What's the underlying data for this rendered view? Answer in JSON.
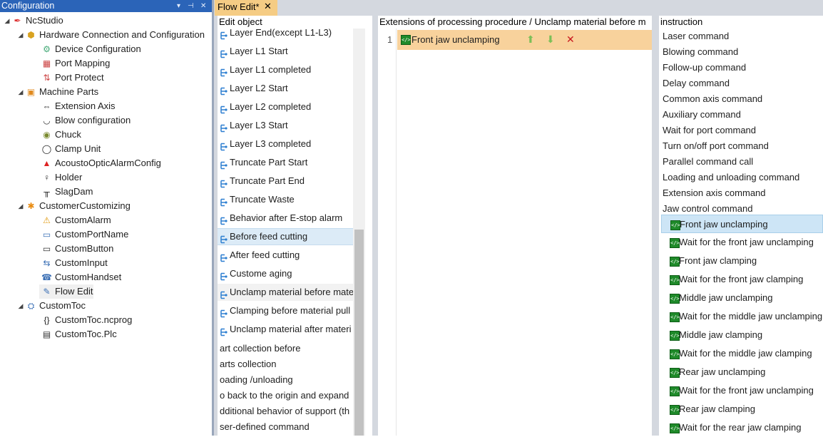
{
  "config_panel": {
    "title": "Configuration",
    "pin_glyph": "▾ ⊣ ✕",
    "tree": [
      {
        "label": "NcStudio",
        "icon": "ncstudio-icon",
        "level": 0,
        "expander": "◢"
      },
      {
        "label": "Hardware Connection and Configuration",
        "icon": "hardware-icon",
        "level": 1,
        "expander": "◢"
      },
      {
        "label": "Device Configuration",
        "icon": "device-config-icon",
        "level": 2
      },
      {
        "label": "Port Mapping",
        "icon": "port-mapping-icon",
        "level": 2
      },
      {
        "label": "Port Protect",
        "icon": "port-protect-icon",
        "level": 2
      },
      {
        "label": "Machine Parts",
        "icon": "machine-parts-icon",
        "level": 1,
        "expander": "◢"
      },
      {
        "label": "Extension Axis",
        "icon": "extension-axis-icon",
        "level": 2
      },
      {
        "label": "Blow configuration",
        "icon": "blow-icon",
        "level": 2
      },
      {
        "label": "Chuck",
        "icon": "chuck-icon",
        "level": 2
      },
      {
        "label": "Clamp Unit",
        "icon": "clamp-icon",
        "level": 2
      },
      {
        "label": "AcoustoOpticAlarmConfig",
        "icon": "alarm-light-icon",
        "level": 2
      },
      {
        "label": "Holder",
        "icon": "holder-icon",
        "level": 2
      },
      {
        "label": "SlagDam",
        "icon": "slagdam-icon",
        "level": 2
      },
      {
        "label": "CustomerCustomizing",
        "icon": "customizing-icon",
        "level": 1,
        "expander": "◢"
      },
      {
        "label": "CustomAlarm",
        "icon": "warning-icon",
        "level": 2
      },
      {
        "label": "CustomPortName",
        "icon": "port-name-icon",
        "level": 2
      },
      {
        "label": "CustomButton",
        "icon": "button-icon",
        "level": 2
      },
      {
        "label": "CustomInput",
        "icon": "input-icon",
        "level": 2
      },
      {
        "label": "CustomHandset",
        "icon": "handset-icon",
        "level": 2
      },
      {
        "label": "Flow Edit",
        "icon": "flow-edit-icon",
        "level": 2,
        "selected": true
      },
      {
        "label": "CustomToc",
        "icon": "customtoc-icon",
        "level": 1,
        "expander": "◢"
      },
      {
        "label": "CustomToc.ncprog",
        "icon": "ncprog-icon",
        "level": 2
      },
      {
        "label": "CustomToc.Plc",
        "icon": "plc-icon",
        "level": 2
      }
    ]
  },
  "tabs": {
    "active_label": "Flow Edit*",
    "close_glyph": "✕"
  },
  "edit_object": {
    "header": "Edit object",
    "items": [
      {
        "label": "Layer End(except L1-L3)",
        "icon": true
      },
      {
        "label": "Layer L1 Start",
        "icon": true
      },
      {
        "label": "Layer L1 completed",
        "icon": true
      },
      {
        "label": "Layer L2 Start",
        "icon": true
      },
      {
        "label": "Layer L2 completed",
        "icon": true
      },
      {
        "label": "Layer L3 Start",
        "icon": true
      },
      {
        "label": "Layer L3 completed",
        "icon": true
      },
      {
        "label": "Truncate Part Start",
        "icon": true
      },
      {
        "label": "Truncate Part End",
        "icon": true
      },
      {
        "label": "Truncate Waste",
        "icon": true
      },
      {
        "label": "Behavior after E-stop alarm",
        "icon": true
      },
      {
        "label": "Before feed cutting",
        "icon": true,
        "selected": true
      },
      {
        "label": "After feed cutting",
        "icon": true
      },
      {
        "label": "Custome aging",
        "icon": true
      },
      {
        "label": "Unclamp material before mate",
        "icon": true,
        "hover": true
      },
      {
        "label": "Clamping before material pull",
        "icon": true
      },
      {
        "label": "Unclamp material after materi",
        "icon": true
      },
      {
        "label": "art collection before",
        "icon": false
      },
      {
        "label": "arts collection",
        "icon": false
      },
      {
        "label": "oading /unloading",
        "icon": false
      },
      {
        "label": "o back to the origin and expand",
        "icon": false
      },
      {
        "label": "dditional behavior of support (th",
        "icon": false
      },
      {
        "label": "ser-defined command",
        "icon": false
      }
    ]
  },
  "extensions": {
    "header": "Extensions of processing procedure / Unclamp material before m",
    "rows": [
      {
        "line": "1",
        "label": "Front jaw unclamping"
      }
    ],
    "buttons": {
      "up_glyph": "⬆",
      "down_glyph": "⬇",
      "delete_glyph": "✕"
    }
  },
  "instruction": {
    "header": "instruction",
    "categories": [
      "Laser command",
      "Blowing command",
      "Follow-up command",
      "Delay command",
      "Common axis command",
      "Auxiliary command",
      "Wait for port command",
      "Turn on/off port command",
      "Parallel command call",
      "Loading and unloading command",
      "Extension axis command",
      "Jaw control command"
    ],
    "jaw_commands": [
      {
        "label": "Front jaw unclamping",
        "selected": true
      },
      {
        "label": "Wait for the front jaw unclamping"
      },
      {
        "label": "Front jaw clamping"
      },
      {
        "label": "Wait for the front jaw clamping"
      },
      {
        "label": "Middle jaw unclamping"
      },
      {
        "label": "Wait for the middle jaw unclamping"
      },
      {
        "label": "Middle jaw clamping"
      },
      {
        "label": "Wait for the middle jaw clamping"
      },
      {
        "label": "Rear jaw unclamping"
      },
      {
        "label": "Wait for the front jaw unclamping"
      },
      {
        "label": "Rear jaw clamping"
      },
      {
        "label": "Wait for the rear jaw clamping"
      }
    ]
  },
  "colors": {
    "header_blue": "#2b64b8",
    "tab_active": "#f5cc84",
    "row_highlight": "#f8d29c",
    "selection_blue": "#cde5f6",
    "command_green": "#1f8a2a",
    "delete_red": "#c8161d",
    "arrow_green": "#7cbf57"
  }
}
